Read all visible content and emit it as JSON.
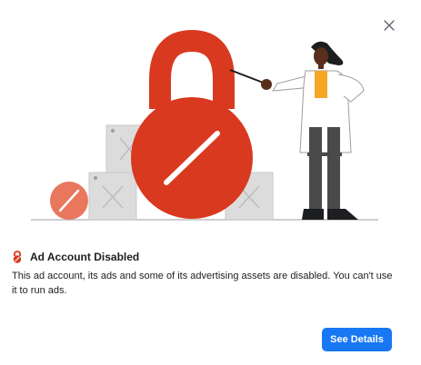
{
  "dialog": {
    "title": "Ad Account Disabled",
    "description": "This ad account, its ads and some of its advertising assets are disabled. You can't use it to run ads.",
    "primary_button": "See Details",
    "close_icon": "close-icon",
    "title_icon": "lock-icon"
  },
  "colors": {
    "accent": "#1877f2",
    "lock_red": "#d9391f",
    "salmon": "#e8775e",
    "box_gray": "#d8d8d8",
    "skin": "#5a2e1c",
    "vest": "#f5a623"
  }
}
